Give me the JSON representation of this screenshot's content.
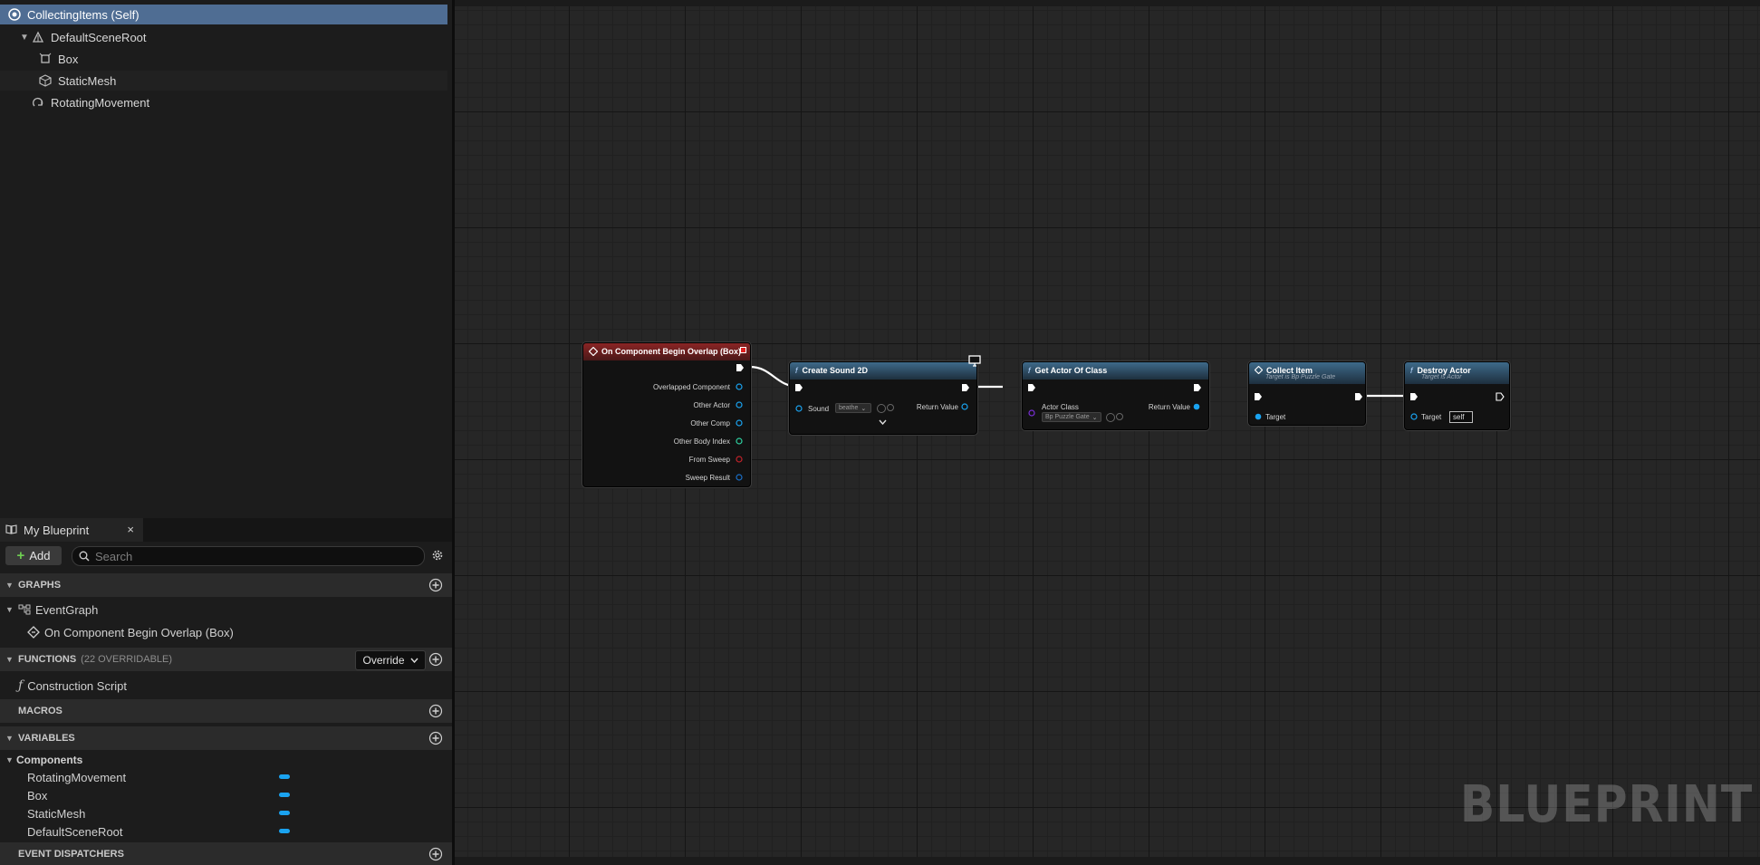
{
  "components": {
    "root_label": "CollectingItems (Self)",
    "items": [
      {
        "label": "DefaultSceneRoot"
      },
      {
        "label": "Box"
      },
      {
        "label": "StaticMesh"
      },
      {
        "label": "RotatingMovement"
      }
    ]
  },
  "my_blueprint": {
    "tab_label": "My Blueprint",
    "close_glyph": "×",
    "add_label": "Add",
    "search_placeholder": "Search",
    "sections": {
      "graphs": "GRAPHS",
      "functions": "FUNCTIONS",
      "functions_sub": "(22 OVERRIDABLE)",
      "override_label": "Override",
      "macros": "MACROS",
      "variables": "VARIABLES",
      "dispatchers": "EVENT DISPATCHERS"
    },
    "graphs": [
      {
        "label": "EventGraph"
      },
      {
        "label": "On Component Begin Overlap (Box)"
      }
    ],
    "functions": [
      {
        "label": "Construction Script"
      }
    ],
    "variables": {
      "category": "Components",
      "items": [
        {
          "label": "RotatingMovement"
        },
        {
          "label": "Box"
        },
        {
          "label": "StaticMesh"
        },
        {
          "label": "DefaultSceneRoot"
        }
      ]
    }
  },
  "graph": {
    "watermark": "BLUEPRINT",
    "nodes": {
      "overlap": {
        "title": "On Component Begin Overlap (Box)",
        "pins": [
          "Overlapped Component",
          "Other Actor",
          "Other Comp",
          "Other Body Index",
          "From Sweep",
          "Sweep Result"
        ]
      },
      "sound": {
        "fn_glyph": "f",
        "title": "Create Sound 2D",
        "sound_label": "Sound",
        "sound_value": "beathe",
        "return_label": "Return Value"
      },
      "getactor": {
        "fn_glyph": "f",
        "title": "Get Actor Of Class",
        "class_label": "Actor Class",
        "class_value": "Bp Puzzle Gate",
        "return_label": "Return Value"
      },
      "collect": {
        "title": "Collect Item",
        "subtitle": "Target is Bp Puzzle Gate",
        "target_label": "Target"
      },
      "destroy": {
        "fn_glyph": "f",
        "title": "Destroy Actor",
        "subtitle": "Target is Actor",
        "target_label": "Target",
        "target_value": "self"
      }
    }
  },
  "colors": {
    "selection": "#4f6d93",
    "event_header": "#8a2525",
    "function_header": "#3e6a8a",
    "object_pin": "#1aa3f0",
    "class_pin": "#7a2fd6",
    "bool_pin": "#c0222a",
    "int_pin": "#2fd0a0",
    "struct_pin": "#1a6fc8"
  }
}
